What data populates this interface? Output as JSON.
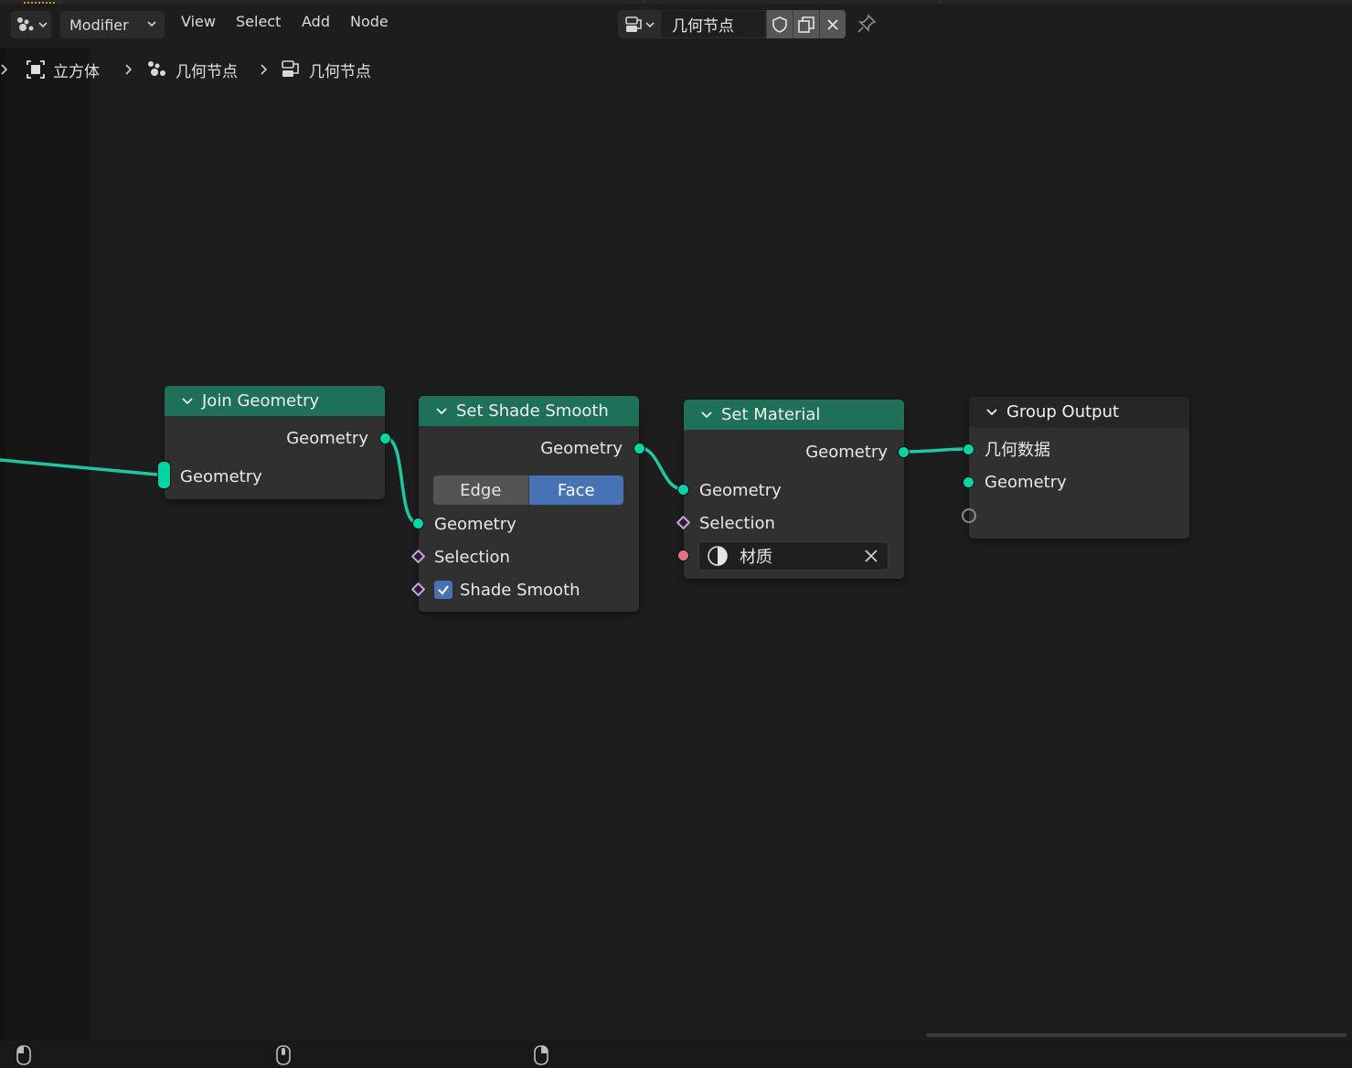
{
  "header": {
    "editor_type_icon": "node-editor-icon",
    "context_dropdown": "Modifier",
    "menus": [
      "View",
      "Select",
      "Add",
      "Node"
    ],
    "datablock_name": "几何节点",
    "datablock_icons": [
      "geometry-nodetree-icon",
      "fake-user-shield-icon",
      "duplicate-icon",
      "close-icon"
    ],
    "pin_icon": "pin-icon"
  },
  "breadcrumb": {
    "items": [
      {
        "label": "立方体",
        "icon": "object-icon"
      },
      {
        "label": "几何节点",
        "icon": "modifier-nodes-icon"
      },
      {
        "label": "几何节点",
        "icon": "nodetree-icon"
      }
    ]
  },
  "nodes": {
    "join_geometry": {
      "title": "Join Geometry",
      "output": "Geometry",
      "input": "Geometry"
    },
    "set_shade_smooth": {
      "title": "Set Shade Smooth",
      "output": "Geometry",
      "domain_options": [
        "Edge",
        "Face"
      ],
      "domain_selected": "Face",
      "inputs": [
        "Geometry",
        "Selection",
        "Shade Smooth"
      ],
      "shade_smooth_checked": true
    },
    "set_material": {
      "title": "Set Material",
      "output": "Geometry",
      "inputs": [
        "Geometry",
        "Selection"
      ],
      "material_name": "材质"
    },
    "group_output": {
      "title": "Group Output",
      "inputs": [
        "几何数据",
        "Geometry"
      ]
    }
  },
  "colors": {
    "geometry_socket": "#00d6a3",
    "geometry_header": "#1e7059",
    "selection_socket": "#c9a2e0",
    "material_socket": "#e57388",
    "active_toggle": "#4772b3",
    "background": "#1d1d1d"
  }
}
